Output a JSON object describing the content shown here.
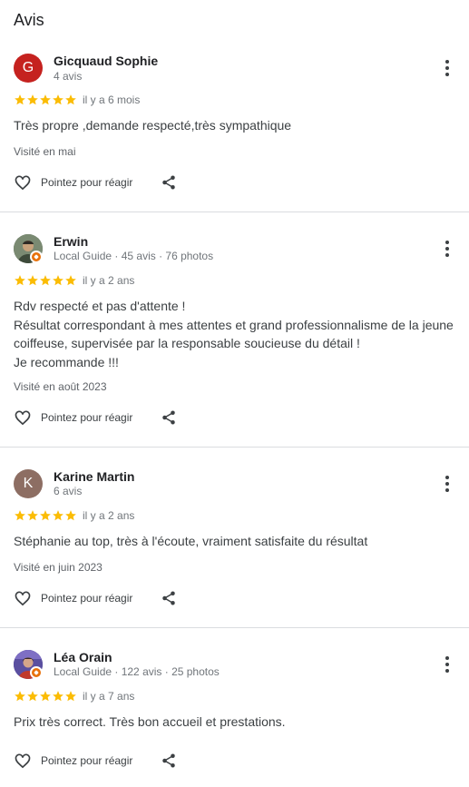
{
  "section_title": "Avis",
  "icons": {
    "star_color": "#fbbc04",
    "more": "more-vert-icon",
    "react": "heart-outline-icon",
    "share": "share-icon"
  },
  "reviews": [
    {
      "avatar_letter": "G",
      "avatar_color": "#c5221f",
      "author": "Gicquaud Sophie",
      "meta": "4 avis",
      "rating": 5,
      "date": "il y a 6 mois",
      "text": "Très propre ,demande respecté,très sympathique",
      "visited": "Visité en mai",
      "react_label": "Pointez pour réagir"
    },
    {
      "avatar_letter": "",
      "avatar_color": "#5f6b5a",
      "local_guide": true,
      "author": "Erwin",
      "meta": "Local Guide · 45 avis · 76 photos",
      "rating": 5,
      "date": "il y a 2 ans",
      "text": "Rdv respecté et pas d'attente !\nRésultat correspondant à mes attentes et grand professionnalisme de la jeune coiffeuse, supervisée par la responsable soucieuse du détail !\nJe recommande !!!",
      "visited": "Visité en août 2023",
      "react_label": "Pointez pour réagir"
    },
    {
      "avatar_letter": "K",
      "avatar_color": "#8d6e63",
      "author": "Karine Martin",
      "meta": "6 avis",
      "rating": 5,
      "date": "il y a 2 ans",
      "text": "Stéphanie au top, très à l'écoute, vraiment satisfaite du résultat",
      "visited": "Visité en juin 2023",
      "react_label": "Pointez pour réagir"
    },
    {
      "avatar_letter": "",
      "avatar_color": "#4a3f8f",
      "local_guide": true,
      "author": "Léa Orain",
      "meta": "Local Guide · 122 avis · 25 photos",
      "rating": 5,
      "date": "il y a 7 ans",
      "text": "Prix très correct. Très bon accueil et prestations.",
      "react_label": "Pointez pour réagir"
    }
  ]
}
